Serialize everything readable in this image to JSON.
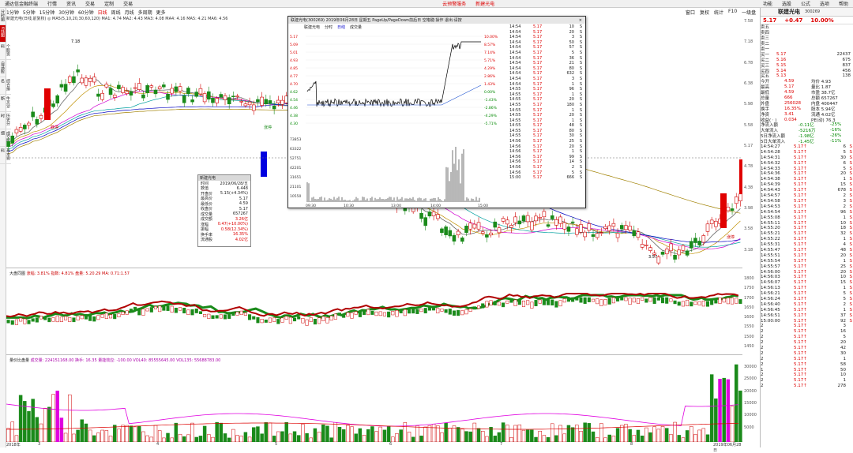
{
  "menubar": {
    "items": [
      "通达信金融终端",
      "行情",
      "资讯",
      "交易",
      "定制",
      "交易"
    ],
    "center_items": [
      "云预警服务",
      "新建光电"
    ],
    "right_items": [
      "功能",
      "选股",
      "公式",
      "选项",
      "帮助"
    ]
  },
  "toolbar": {
    "tabs": [
      "1分钟",
      "5分钟",
      "15分钟",
      "30分钟",
      "60分钟",
      "日线",
      "周线",
      "月线",
      "多周期",
      "更多"
    ],
    "active": "日线",
    "right": [
      "窗口",
      "复权",
      "统计",
      "F10",
      "一级盘",
      "叠加"
    ]
  },
  "left_tabs": [
    "分时图",
    "K线图",
    "个股资料",
    "自选股",
    "综合排名",
    "牛叉诊断",
    "历史分时",
    "成交明细",
    "基本资料"
  ],
  "indicators_line": "新建光电(日线,前复权) ◎ MA5(5,10,20,30,60,120) MA1: 4.74 MA2: 4.43 MA3: 4.08 MA4: 4.16 MA5: 4.21 MA6: 4.56",
  "main_annotations": {
    "high": "7.18",
    "low": "3.57",
    "tags": [
      "跌停",
      "涨停",
      "涨停",
      "跌停"
    ]
  },
  "mid_panel": {
    "label": "大盘同图",
    "values": "涨幅: 3.81% 指数: 4.81% 盘量: 5.20.29 MA: 0.71:1.57"
  },
  "vol_panel": {
    "label": "量价比盘量",
    "values": "成交量: 224151168.00 换手: 16.35 量能效应: -100.00 VOL40: 85555645.00 VOL135: 55688783.00"
  },
  "xaxis": [
    "2018年",
    "3",
    "4",
    "5",
    "6",
    "7",
    "8",
    "2019年06月28日"
  ],
  "right_panel": {
    "name": "联建光电",
    "code": "300269",
    "price": "5.17",
    "change": "+0.47",
    "pct": "10.00%",
    "sell": [
      [
        "卖五",
        "",
        " "
      ],
      [
        "卖四",
        "",
        ""
      ],
      [
        "卖三",
        "",
        ""
      ],
      [
        "卖二",
        "",
        ""
      ],
      [
        "卖一",
        "",
        ""
      ]
    ],
    "buy": [
      [
        "买一",
        "5.17",
        "22437"
      ],
      [
        "买二",
        "5.16",
        "675"
      ],
      [
        "买三",
        "5.15",
        "837"
      ],
      [
        "买四",
        "5.14",
        "456"
      ],
      [
        "买五",
        "5.13",
        "138"
      ]
    ],
    "stats": [
      [
        "今开",
        "4.59",
        "均价 4.93"
      ],
      [
        "最高",
        "5.17",
        "量比 1.87"
      ],
      [
        "最低",
        "4.59",
        "市盈 38.7亿"
      ],
      [
        "总量",
        "666",
        "总额 657267"
      ],
      [
        "外盘",
        "256028",
        "内盘 400447"
      ],
      [
        "换手",
        "16.35%",
        "股本 5.94亿"
      ],
      [
        "净资",
        "3.41",
        "流通 4.02亿"
      ],
      [
        "收益(ㆍ)",
        "0.034",
        "PE(动) 76.3"
      ]
    ],
    "flows": [
      [
        "净流入额",
        "-0.11亿",
        "-25%"
      ],
      [
        "大单流入",
        "-5216万",
        "-16%"
      ],
      [
        "5日净流入额",
        "-1.98亿",
        "-26%"
      ],
      [
        "5日大单流入",
        "-1.45亿",
        "-11%"
      ]
    ],
    "ticks": [
      [
        "14:54:27",
        "5.17↑",
        "6",
        "S"
      ],
      [
        "14:54:28",
        "5.17↑",
        "5",
        "S"
      ],
      [
        "14:54:31",
        "5.17↑",
        "30",
        "S"
      ],
      [
        "14:54:32",
        "5.17↑",
        "6",
        "S"
      ],
      [
        "14:54:33",
        "5.17↑",
        "5",
        "S"
      ],
      [
        "14:54:36",
        "5.17↑",
        "20",
        "S"
      ],
      [
        "14:54:38",
        "5.17↑",
        "1",
        "S"
      ],
      [
        "14:54:39",
        "5.17↑",
        "15",
        "S"
      ],
      [
        "14:54:43",
        "5.17↑",
        "678",
        "S"
      ],
      [
        "14:54:57",
        "5.17↑",
        "2",
        "S"
      ],
      [
        "14:54:58",
        "5.17↑",
        "3",
        "S"
      ],
      [
        "14:54:53",
        "5.17↑",
        "2",
        "S"
      ],
      [
        "14:54:54",
        "5.17↑",
        "96",
        "S"
      ],
      [
        "14:55:08",
        "5.17↑",
        "1",
        "S"
      ],
      [
        "14:55:11",
        "5.17↑",
        "10",
        "S"
      ],
      [
        "14:55:20",
        "5.17↑",
        "18",
        "S"
      ],
      [
        "14:55:21",
        "5.17↑",
        "32",
        "S"
      ],
      [
        "14:55:22",
        "5.17↑",
        "1",
        "S"
      ],
      [
        "14:55:31",
        "5.17↑",
        "4",
        "S"
      ],
      [
        "14:55:47",
        "5.17↑",
        "48",
        "S"
      ],
      [
        "14:55:51",
        "5.17↑",
        "20",
        "S"
      ],
      [
        "14:55:54",
        "5.17↑",
        "1",
        "S"
      ],
      [
        "14:55:57",
        "5.17↑",
        "25",
        "S"
      ],
      [
        "14:56:00",
        "5.17↑",
        "20",
        "S"
      ],
      [
        "14:56:03",
        "5.17↑",
        "10",
        "S"
      ],
      [
        "14:56:07",
        "5.17↑",
        "15",
        "S"
      ],
      [
        "14:56:13",
        "5.17↑",
        "1",
        "S"
      ],
      [
        "14:56:21",
        "5.17↑",
        "5",
        "S"
      ],
      [
        "14:56:24",
        "5.17↑",
        "5",
        "S"
      ],
      [
        "14:56:40",
        "5.17↑",
        "2",
        "S"
      ],
      [
        "14:56:45",
        "5.17↑",
        "1",
        "S"
      ],
      [
        "14:56:51",
        "5.17↑",
        "37",
        "S"
      ],
      [
        "15:00:00",
        "5.17↑",
        "92",
        "S"
      ],
      [
        "2",
        "5.17↑",
        "3",
        ""
      ],
      [
        "2",
        "5.17↑",
        "16",
        ""
      ],
      [
        "2",
        "5.17↑",
        "5",
        ""
      ],
      [
        "2",
        "5.17↑",
        "20",
        ""
      ],
      [
        "2",
        "5.17↑",
        "42",
        ""
      ],
      [
        "2",
        "5.17↑",
        "30",
        ""
      ],
      [
        "2",
        "5.17↑",
        "1",
        ""
      ],
      [
        "2",
        "5.17↑",
        "58",
        ""
      ],
      [
        "1",
        "5.17↑",
        "50",
        ""
      ],
      [
        "2",
        "5.17↑",
        "10",
        ""
      ],
      [
        "2",
        "5.17↑",
        "1",
        ""
      ],
      [
        "2",
        "5.17↑",
        "278",
        ""
      ]
    ]
  },
  "infobox": {
    "title": "新建光电",
    "rows": [
      [
        "时间",
        "2019/06/28/五"
      ],
      [
        "数值",
        "6.448"
      ],
      [
        "开盘价",
        "5.15(+4.34%)"
      ],
      [
        "最高价",
        "5.17"
      ],
      [
        "最低价",
        "4.59"
      ],
      [
        "收盘价",
        "5.17"
      ],
      [
        "成交量",
        "657267"
      ],
      [
        "成交额",
        "3.26亿"
      ],
      [
        "涨幅",
        "0.47(+10.00%)"
      ],
      [
        "振幅",
        "0.58(12.34%)"
      ],
      [
        "换手率",
        "16.35%"
      ],
      [
        "流通股",
        "4.02亿"
      ]
    ]
  },
  "popup": {
    "title": "联建光电(300269) 2019年06月28日 星期五 PageUp/PageDown前后日 空格键:操作 退出:请按",
    "tabs": [
      "联建光电",
      "分时",
      "日线",
      "成交量"
    ],
    "close": "×",
    "yleft": [
      "5.17",
      "5.09",
      "5.01",
      "4.93",
      "4.85",
      "4.77",
      "4.70",
      "4.62",
      "4.54",
      "4.46",
      "4.38",
      "4.30"
    ],
    "yright": [
      "10.00%",
      "8.57%",
      "7.14%",
      "5.71%",
      "4.29%",
      "2.86%",
      "1.43%",
      "0.00%",
      "-1.43%",
      "-2.86%",
      "-4.29%",
      "-5.71%"
    ],
    "vol_axis": [
      "73853",
      "63322",
      "52751",
      "42201",
      "31651",
      "21101",
      "10550"
    ],
    "xaxis": [
      "09:30",
      "10:30",
      "13:00",
      "14:00",
      "15:00"
    ],
    "ticks": [
      [
        "14:54",
        "5.17",
        "10",
        "S"
      ],
      [
        "14:54",
        "5.17",
        "20",
        "S"
      ],
      [
        "14:54",
        "5.17",
        "3",
        "S"
      ],
      [
        "14:54",
        "5.17",
        "50",
        "S"
      ],
      [
        "14:54",
        "5.17",
        "57",
        "S"
      ],
      [
        "14:54",
        "5.17",
        "5",
        "S"
      ],
      [
        "14:54",
        "5.17",
        "36",
        "S"
      ],
      [
        "14:54",
        "5.17",
        "21",
        "S"
      ],
      [
        "14:54",
        "5.17",
        "80",
        "S"
      ],
      [
        "14:54",
        "5.17",
        "632",
        "S"
      ],
      [
        "14:54",
        "5.17",
        "3",
        "S"
      ],
      [
        "14:54",
        "5.17",
        "1",
        "S"
      ],
      [
        "14:55",
        "5.17",
        "96",
        "S"
      ],
      [
        "14:55",
        "5.17",
        "1",
        "S"
      ],
      [
        "14:55",
        "5.17",
        "20",
        "S"
      ],
      [
        "14:55",
        "5.17",
        "180",
        "S"
      ],
      [
        "14:55",
        "5.17",
        "1",
        "S"
      ],
      [
        "14:55",
        "5.17",
        "20",
        "S"
      ],
      [
        "14:55",
        "5.17",
        "1",
        "S"
      ],
      [
        "14:55",
        "5.17",
        "48",
        "S"
      ],
      [
        "14:55",
        "5.17",
        "80",
        "S"
      ],
      [
        "14:55",
        "5.17",
        "30",
        "S"
      ],
      [
        "14:56",
        "5.17",
        "25",
        "S"
      ],
      [
        "14:56",
        "5.17",
        "20",
        "S"
      ],
      [
        "14:56",
        "5.17",
        "1",
        "S"
      ],
      [
        "14:56",
        "5.17",
        "99",
        "S"
      ],
      [
        "14:56",
        "5.17",
        "14",
        "S"
      ],
      [
        "14:56",
        "5.17",
        "2",
        "S"
      ],
      [
        "14:56",
        "5.17",
        "5",
        "S"
      ],
      [
        "15:00",
        "5.17",
        "666",
        "S"
      ]
    ]
  },
  "main_yaxis": [
    "7.58",
    "7.18",
    "6.78",
    "6.38",
    "5.98",
    "5.58",
    "5.17",
    "4.78",
    "4.38",
    "3.98",
    "3.58",
    "3.18"
  ],
  "mid_yaxis": [
    "1800",
    "1750",
    "1700",
    "1650",
    "1600",
    "1550",
    "1500",
    "1450"
  ],
  "vol_yaxis": [
    "30000",
    "25000",
    "20000",
    "15000",
    "10000",
    "5000"
  ],
  "colors": {
    "up": "#d00000",
    "down": "#1a8a1a",
    "ma1": "#555555",
    "ma2": "#c09000",
    "ma3": "#d000d0",
    "ma4": "#00a0a0",
    "ma5": "#0000c0",
    "ma6": "#a08000"
  }
}
